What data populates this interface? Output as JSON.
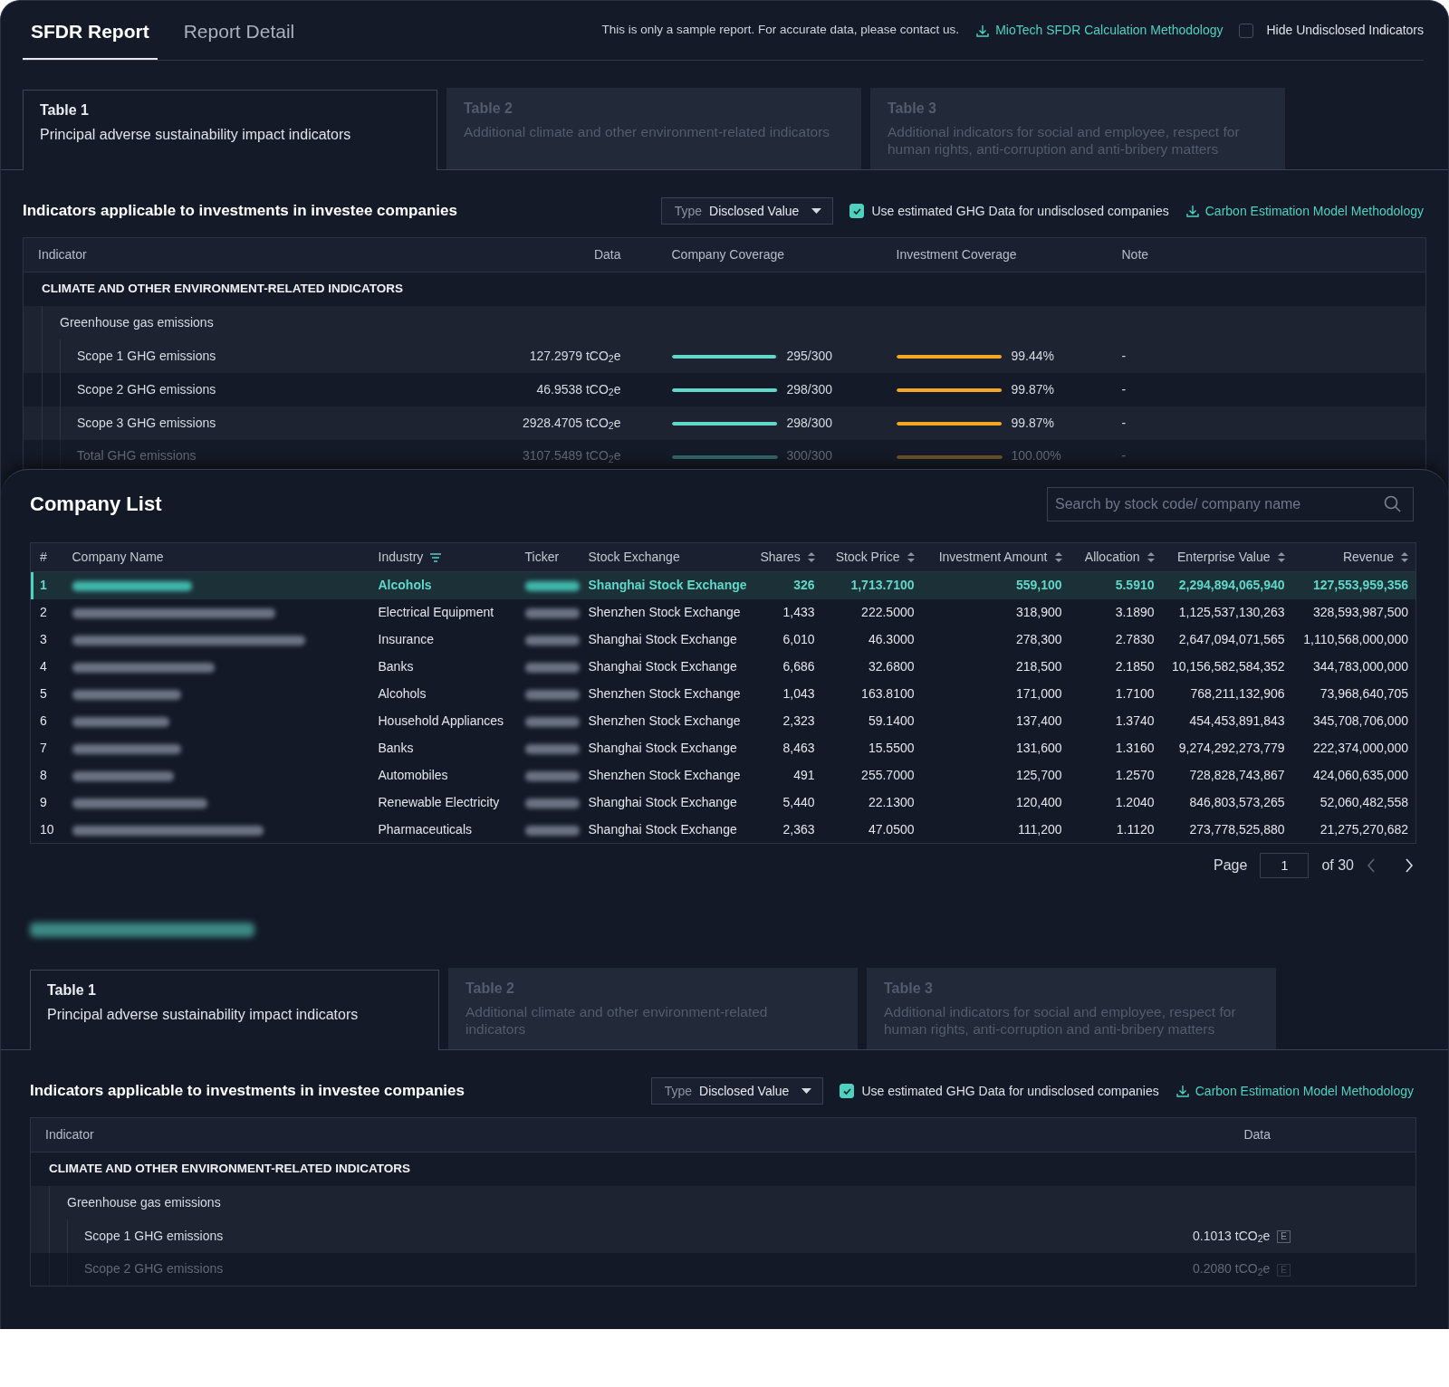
{
  "header": {
    "tabs": [
      {
        "label": "SFDR Report",
        "selected": true
      },
      {
        "label": "Report Detail",
        "selected": false
      }
    ],
    "notice": "This is only a sample report. For accurate data, please contact us.",
    "methodology_link": "MioTech SFDR Calculation Methodology",
    "hide_undisclosed": {
      "label": "Hide Undisclosed Indicators",
      "checked": false
    }
  },
  "report": {
    "table_tabs": [
      {
        "title": "Table 1",
        "subtitle": "Principal adverse sustainability impact indicators",
        "selected": true
      },
      {
        "title": "Table 2",
        "subtitle": "Additional climate and other environment-related indicators",
        "selected": false
      },
      {
        "title": "Table 3",
        "subtitle": "Additional indicators for social and employee, respect for human rights, anti-corruption and anti-bribery matters",
        "selected": false
      }
    ],
    "section_title": "Indicators applicable to investments in investee companies",
    "type_filter": {
      "label": "Type",
      "value": "Disclosed Value"
    },
    "estimate_option": {
      "label": "Use estimated GHG Data for undisclosed companies",
      "checked": true
    },
    "estimate_link": "Carbon Estimation Model Methodology",
    "columns": [
      "Indicator",
      "Data",
      "Company Coverage",
      "Investment Coverage",
      "Note"
    ],
    "category": "CLIMATE AND OTHER ENVIRONMENT-RELATED INDICATORS",
    "group": "Greenhouse gas emissions",
    "rows": [
      {
        "name": "Scope 1 GHG emissions",
        "data": "127.2979 tCO$_{2}$e",
        "company_coverage": {
          "level": 0.983,
          "text": "295/300"
        },
        "investment_coverage": {
          "level": 0.9944,
          "text": "99.44%"
        },
        "note": "-"
      },
      {
        "name": "Scope 2 GHG emissions",
        "data": "46.9538 tCO$_{2}$e",
        "company_coverage": {
          "level": 0.993,
          "text": "298/300"
        },
        "investment_coverage": {
          "level": 0.9987,
          "text": "99.87%"
        },
        "note": "-"
      },
      {
        "name": "Scope 3 GHG emissions",
        "data": "2928.4705 tCO$_{2}$e",
        "company_coverage": {
          "level": 0.993,
          "text": "298/300"
        },
        "investment_coverage": {
          "level": 0.9987,
          "text": "99.87%"
        },
        "note": "-"
      },
      {
        "name": "Total GHG emissions",
        "data": "3107.5489 tCO$_{2}$e",
        "company_coverage": {
          "level": 1,
          "text": "300/300"
        },
        "investment_coverage": {
          "level": 1,
          "text": "100.00%"
        },
        "note": "-"
      }
    ]
  },
  "company_list": {
    "title": "Company List",
    "search": {
      "placeholder": "Search by stock code/ company name"
    },
    "columns": [
      {
        "label": "#",
        "kind": "plain"
      },
      {
        "label": "Company Name",
        "kind": "plain"
      },
      {
        "label": "Industry",
        "kind": "filter"
      },
      {
        "label": "Ticker",
        "kind": "plain"
      },
      {
        "label": "Stock Exchange",
        "kind": "plain"
      },
      {
        "label": "Shares",
        "kind": "sortable"
      },
      {
        "label": "Stock Price",
        "kind": "sortable"
      },
      {
        "label": "Investment Amount",
        "kind": "sortable"
      },
      {
        "label": "Allocation",
        "kind": "sortable"
      },
      {
        "label": "Enterprise Value",
        "kind": "sortable"
      },
      {
        "label": "Revenue",
        "kind": "sortable"
      }
    ],
    "rows": [
      {
        "no": "1",
        "industry": "Alcohols",
        "exchange": "Shanghai Stock Exchange",
        "shares": "326",
        "price": "1,713.7100",
        "amount": "559,100",
        "allocation": "5.5910",
        "enterprise_value": "2,294,894,065,940",
        "revenue": "127,553,959,356",
        "selected": true
      },
      {
        "no": "2",
        "industry": "Electrical Equipment",
        "exchange": "Shenzhen Stock Exchange",
        "shares": "1,433",
        "price": "222.5000",
        "amount": "318,900",
        "allocation": "3.1890",
        "enterprise_value": "1,125,537,130,263",
        "revenue": "328,593,987,500",
        "selected": false
      },
      {
        "no": "3",
        "industry": "Insurance",
        "exchange": "Shanghai Stock Exchange",
        "shares": "6,010",
        "price": "46.3000",
        "amount": "278,300",
        "allocation": "2.7830",
        "enterprise_value": "2,647,094,071,565",
        "revenue": "1,110,568,000,000",
        "selected": false
      },
      {
        "no": "4",
        "industry": "Banks",
        "exchange": "Shanghai Stock Exchange",
        "shares": "6,686",
        "price": "32.6800",
        "amount": "218,500",
        "allocation": "2.1850",
        "enterprise_value": "10,156,582,584,352",
        "revenue": "344,783,000,000",
        "selected": false
      },
      {
        "no": "5",
        "industry": "Alcohols",
        "exchange": "Shenzhen Stock Exchange",
        "shares": "1,043",
        "price": "163.8100",
        "amount": "171,000",
        "allocation": "1.7100",
        "enterprise_value": "768,211,132,906",
        "revenue": "73,968,640,705",
        "selected": false
      },
      {
        "no": "6",
        "industry": "Household Appliances",
        "exchange": "Shenzhen Stock Exchange",
        "shares": "2,323",
        "price": "59.1400",
        "amount": "137,400",
        "allocation": "1.3740",
        "enterprise_value": "454,453,891,843",
        "revenue": "345,708,706,000",
        "selected": false
      },
      {
        "no": "7",
        "industry": "Banks",
        "exchange": "Shanghai Stock Exchange",
        "shares": "8,463",
        "price": "15.5500",
        "amount": "131,600",
        "allocation": "1.3160",
        "enterprise_value": "9,274,292,273,779",
        "revenue": "222,374,000,000",
        "selected": false
      },
      {
        "no": "8",
        "industry": "Automobiles",
        "exchange": "Shenzhen Stock Exchange",
        "shares": "491",
        "price": "255.7000",
        "amount": "125,700",
        "allocation": "1.2570",
        "enterprise_value": "728,828,743,867",
        "revenue": "424,060,635,000",
        "selected": false
      },
      {
        "no": "9",
        "industry": "Renewable Electricity",
        "exchange": "Shanghai Stock Exchange",
        "shares": "5,440",
        "price": "22.1300",
        "amount": "120,400",
        "allocation": "1.2040",
        "enterprise_value": "846,803,573,265",
        "revenue": "52,060,482,558",
        "selected": false
      },
      {
        "no": "10",
        "industry": "Pharmaceuticals",
        "exchange": "Shanghai Stock Exchange",
        "shares": "2,363",
        "price": "47.0500",
        "amount": "111,200",
        "allocation": "1.1120",
        "enterprise_value": "273,778,525,880",
        "revenue": "21,275,270,682",
        "selected": false
      }
    ],
    "pagination": {
      "label": "Page",
      "value": "1",
      "total": "of 30"
    }
  },
  "detail": {
    "table_tabs": [
      {
        "title": "Table 1",
        "subtitle": "Principal adverse sustainability impact indicators",
        "selected": true
      },
      {
        "title": "Table 2",
        "subtitle": "Additional climate and other environment-related indicators",
        "selected": false
      },
      {
        "title": "Table 3",
        "subtitle": "Additional indicators for social and employee, respect for human rights, anti-corruption and anti-bribery matters",
        "selected": false
      }
    ],
    "section_title": "Indicators applicable to investments in investee companies",
    "type_filter": {
      "label": "Type",
      "value": "Disclosed Value"
    },
    "estimate_option": {
      "label": "Use estimated GHG Data for undisclosed companies",
      "checked": true
    },
    "estimate_link": "Carbon Estimation Model Methodology",
    "columns": [
      "Indicator",
      "Data"
    ],
    "category": "CLIMATE AND OTHER ENVIRONMENT-RELATED INDICATORS",
    "group": "Greenhouse gas emissions",
    "rows": [
      {
        "name": "Scope 1 GHG emissions",
        "data": "0.1013 tCO$_{2}$e",
        "badge": "E"
      },
      {
        "name": "Scope 2 GHG emissions",
        "data": "0.2080 tCO$_{2}$e",
        "badge": "E"
      }
    ]
  }
}
